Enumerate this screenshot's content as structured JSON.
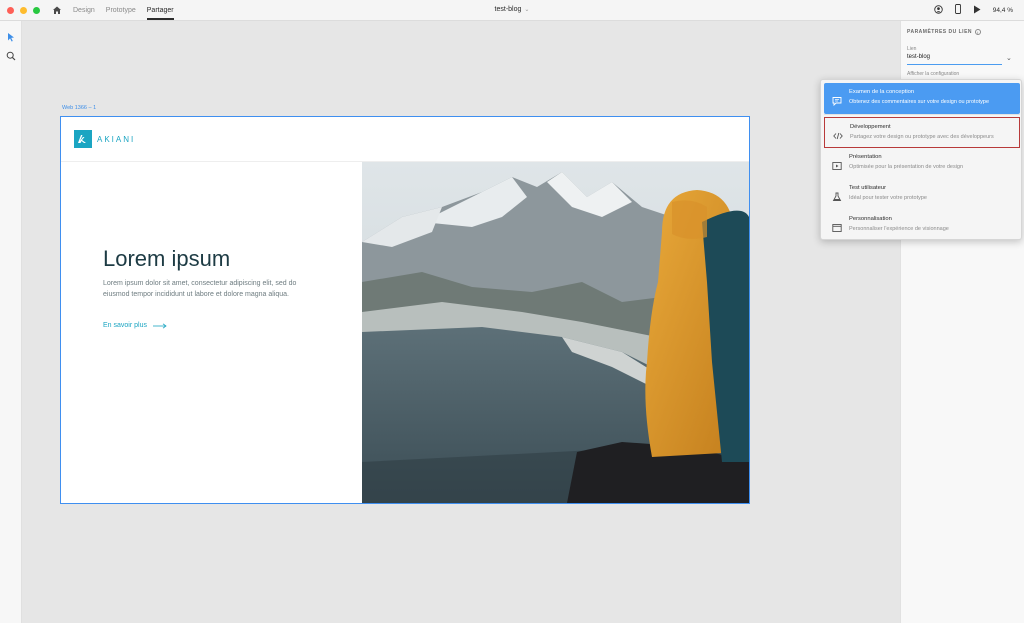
{
  "window": {
    "tabs": [
      "Design",
      "Prototype",
      "Partager"
    ],
    "active_tab": "Partager",
    "document_title": "test-blog",
    "zoom": "94,4 %"
  },
  "canvas": {
    "artboard_label": "Web 1366 – 1"
  },
  "artboard": {
    "logo_text": "AKIANI",
    "hero_title": "Lorem ipsum",
    "hero_text": "Lorem ipsum dolor sit amet, consectetur adipiscing elit, sed do eiusmod tempor incididunt ut labore et dolore magna aliqua.",
    "hero_link": "En savoir plus"
  },
  "right_panel": {
    "title": "PARAMÈTRES DU LIEN",
    "link_label": "Lien",
    "link_value": "test-blog",
    "config_label": "Afficher la configuration"
  },
  "share_menu": {
    "items": [
      {
        "label": "Examen de la conception",
        "description": "Obtenez des commentaires sur votre design ou prototype",
        "icon": "comment-icon",
        "state": "selected"
      },
      {
        "label": "Développement",
        "description": "Partagez votre design ou prototype avec des développeurs",
        "icon": "code-icon",
        "state": "highlighted"
      },
      {
        "label": "Présentation",
        "description": "Optimisée pour la présentation de votre design",
        "icon": "play-icon",
        "state": "normal"
      },
      {
        "label": "Test utilisateur",
        "description": "Idéal pour tester votre prototype",
        "icon": "flask-icon",
        "state": "normal"
      },
      {
        "label": "Personnalisation",
        "description": "Personnaliser l'expérience de visionnage",
        "icon": "window-icon",
        "state": "normal"
      }
    ]
  },
  "colors": {
    "accent": "#4b9bf2",
    "brand": "#1ba5c2",
    "highlight_border": "#b83a3a",
    "artboard_border": "#3f8ff0"
  }
}
